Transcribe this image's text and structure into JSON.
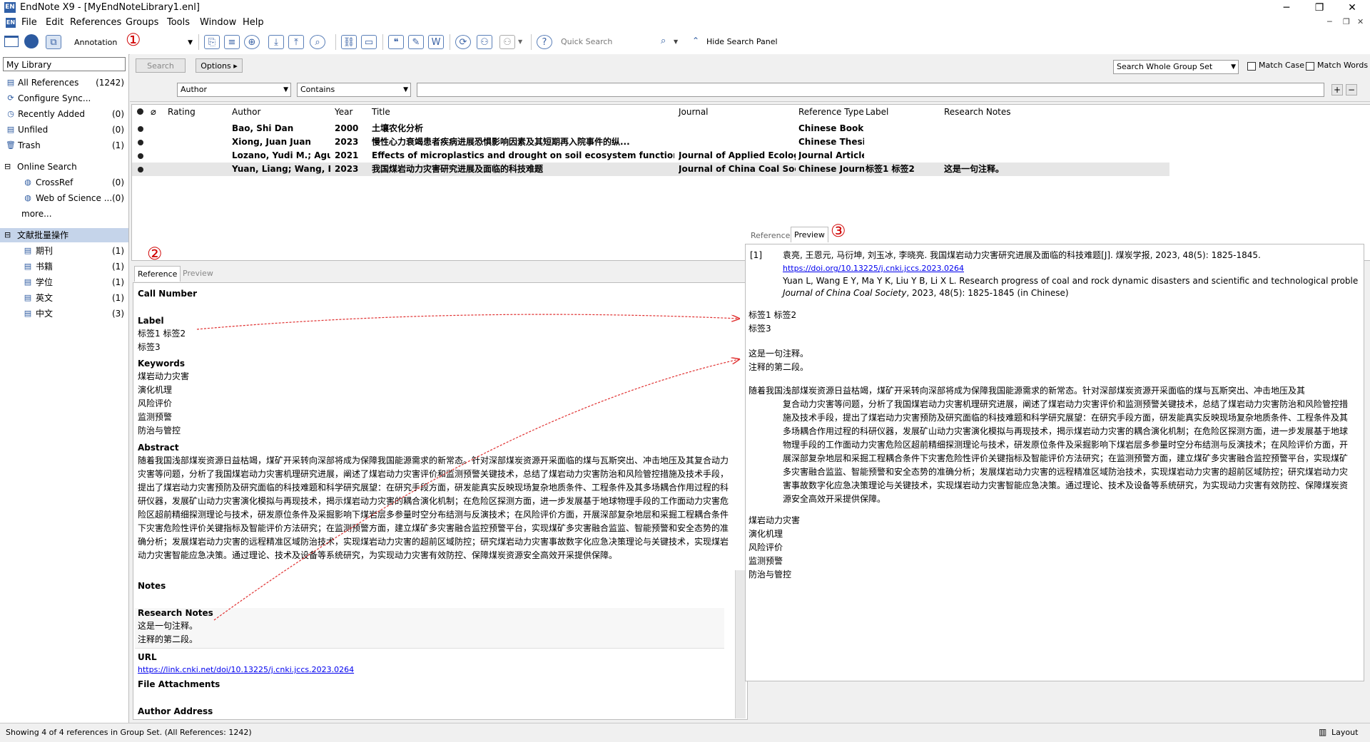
{
  "window": {
    "title": "EndNote X9 - [MyEndNoteLibrary1.enl]",
    "app_badge": "EN"
  },
  "menu": [
    "File",
    "Edit",
    "References",
    "Groups",
    "Tools",
    "Window",
    "Help"
  ],
  "toolbar": {
    "style": "Annotation",
    "quick_search_placeholder": "Quick Search",
    "hide_search_panel": "Hide Search Panel"
  },
  "callouts": {
    "one": "①",
    "two": "②",
    "three": "③"
  },
  "left_panel": {
    "library_box": "My Library",
    "items": [
      {
        "label": "All References",
        "count": "(1242)"
      },
      {
        "label": "Configure Sync...",
        "count": ""
      },
      {
        "label": "Recently Added",
        "count": "(0)"
      },
      {
        "label": "Unfiled",
        "count": "(0)"
      },
      {
        "label": "Trash",
        "count": "(1)"
      }
    ],
    "online_search": {
      "title": "Online Search",
      "items": [
        {
          "label": "CrossRef",
          "count": "(0)"
        },
        {
          "label": "Web of Science ...",
          "count": "(0)"
        }
      ],
      "more": "more..."
    },
    "group_set": {
      "title": "文献批量操作",
      "items": [
        {
          "label": "期刊",
          "count": "(1)"
        },
        {
          "label": "书籍",
          "count": "(1)"
        },
        {
          "label": "学位",
          "count": "(1)"
        },
        {
          "label": "英文",
          "count": "(1)"
        },
        {
          "label": "中文",
          "count": "(3)"
        }
      ]
    }
  },
  "search_panel": {
    "search_btn": "Search",
    "options_btn": "Options ▸",
    "scope": "Search Whole Group Set",
    "match_case": "Match Case",
    "match_words": "Match Words",
    "field": "Author",
    "operator": "Contains"
  },
  "ref_list": {
    "headers": {
      "rating": "Rating",
      "author": "Author",
      "year": "Year",
      "title": "Title",
      "journal": "Journal",
      "type": "Reference Type",
      "label": "Label",
      "notes": "Research Notes"
    },
    "rows": [
      {
        "author": "Bao, Shi Dan",
        "year": "2000",
        "title": "土壤农化分析",
        "journal": "",
        "type": "Chinese Book",
        "label": "",
        "notes": ""
      },
      {
        "author": "Xiong, Juan Juan",
        "year": "2023",
        "title": "慢性心力衰竭患者疾病进展恐惧影响因素及其短期再入院事件的纵...",
        "journal": "",
        "type": "Chinese Thesis",
        "label": "",
        "notes": ""
      },
      {
        "author": "Lozano, Yudi M.; Aguila...",
        "year": "2021",
        "title": "Effects of microplastics and drought on soil ecosystem functions and multi...",
        "journal": "Journal of Applied Ecology",
        "type": "Journal Article",
        "label": "",
        "notes": ""
      },
      {
        "author": "Yuan, Liang; Wang, En ...",
        "year": "2023",
        "title": "我国煤岩动力灾害研究进展及面临的科技难题",
        "journal": "Journal of China Coal Society",
        "type": "Chinese Journal",
        "label": "标签1 标签2",
        "notes": "这是一句注释。"
      }
    ]
  },
  "ref_pane": {
    "tab_reference": "Reference",
    "tab_preview": "Preview",
    "call_number": "Call Number",
    "label_title": "Label",
    "label_value": "标签1 标签2\n标签3",
    "keywords_title": "Keywords",
    "keywords_value": "煤岩动力灾害\n演化机理\n风险评价\n监测预警\n防治与管控",
    "abstract_title": "Abstract",
    "abstract_value": "随着我国浅部煤炭资源日益枯竭，煤矿开采转向深部将成为保障我国能源需求的新常态。针对深部煤炭资源开采面临的煤与瓦斯突出、冲击地压及其复合动力灾害等问题，分析了我国煤岩动力灾害机理研究进展，阐述了煤岩动力灾害评价和监测预警关键技术，总结了煤岩动力灾害防治和风险管控措施及技术手段，提出了煤岩动力灾害预防及研究面临的科技难题和科学研究展望：在研究手段方面，研发能真实反映现场复杂地质条件、工程条件及其多场耦合作用过程的科研仪器，发展矿山动力灾害演化模拟与再现技术，揭示煤岩动力灾害的耦合演化机制；在危险区探测方面，进一步发展基于地球物理手段的工作面动力灾害危险区超前精细探测理论与技术，研发原位条件及采掘影响下煤岩层多参量时空分布结测与反演技术；在风险评价方面，开展深部复杂地层和采掘工程耦合条件下灾害危险性评价关键指标及智能评价方法研究；在监测预警方面，建立煤矿多灾害融合监控预警平台，实现煤矿多灾害融合监监、智能预警和安全态势的准确分析；发展煤岩动力灾害的远程精准区域防治技术，实现煤岩动力灾害的超前区域防控；研究煤岩动力灾害事故数字化应急决策理论与关键技术，实现煤岩动力灾害智能应急决策。通过理论、技术及设备等系统研究，为实现动力灾害有效防控、保障煤炭资源安全高效开采提供保障。",
    "notes_title": "Notes",
    "research_notes_title": "Research Notes",
    "research_notes_value": "这是一句注释。\n注释的第二段。",
    "url_title": "URL",
    "url_value": "https://link.cnki.net/doi/10.13225/j.cnki.jccs.2023.0264",
    "file_attachments_title": "File Attachments",
    "author_address_title": "Author Address"
  },
  "preview_pane": {
    "tab_reference": "Reference",
    "tab_preview": "Preview",
    "citation_num": "[1]",
    "citation_cn": "袁亮, 王恩元, 马衍坤, 刘玉冰, 李晓亮. 我国煤岩动力灾害研究进展及面临的科技难题[J]. 煤炭学报, 2023, 48(5): 1825-1845.",
    "citation_link": "https://doi.org/10.13225/j.cnki.jccs.2023.0264",
    "citation_en": "Yuan L, Wang E Y, Ma Y K, Liu Y B, Li X L. Research progress of coal and rock dynamic disasters and scientific and technological problems in China[J].",
    "citation_en_journal": "Journal of China Coal Society",
    "citation_en_tail": ", 2023, 48(5): 1825-1845 (in Chinese)",
    "labels": "标签1 标签2\n标签3",
    "notes": "这是一句注释。\n注释的第二段。",
    "abstract_first": "随着我国浅部煤炭资源日益枯竭，煤矿开采转向深部将成为保障我国能源需求的新常态。针对深部煤炭资源开采面临的煤与瓦斯突出、冲击地压及其",
    "abstract_rest": "复合动力灾害等问题，分析了我国煤岩动力灾害机理研究进展，阐述了煤岩动力灾害评价和监测预警关键技术，总结了煤岩动力灾害防治和风险管控措施及技术手段，提出了煤岩动力灾害预防及研究面临的科技难题和科学研究展望：在研究手段方面，研发能真实反映现场复杂地质条件、工程条件及其多场耦合作用过程的科研仪器，发展矿山动力灾害演化模拟与再现技术，揭示煤岩动力灾害的耦合演化机制；在危险区探测方面，进一步发展基于地球物理手段的工作面动力灾害危险区超前精细探测理论与技术，研发原位条件及采掘影响下煤岩层多参量时空分布结测与反演技术；在风险评价方面，开展深部复杂地层和采掘工程耦合条件下灾害危险性评价关键指标及智能评价方法研究；在监测预警方面，建立煤矿多灾害融合监控预警平台，实现煤矿多灾害融合监监、智能预警和安全态势的准确分析；发展煤岩动力灾害的远程精准区域防治技术，实现煤岩动力灾害的超前区域防控；研究煤岩动力灾害事故数字化应急决策理论与关键技术，实现煤岩动力灾害智能应急决策。通过理论、技术及设备等系统研究，为实现动力灾害有效防控、保障煤炭资源安全高效开采提供保障。",
    "keywords": "煤岩动力灾害\n演化机理\n风险评价\n监测预警\n防治与管控"
  },
  "status": {
    "text": "Showing 4 of 4 references in Group Set. (All References: 1242)",
    "layout": "Layout"
  },
  "colors": {
    "accent": "#3060a8",
    "callout": "#d00000",
    "selected_group": "#c5d4ea"
  }
}
